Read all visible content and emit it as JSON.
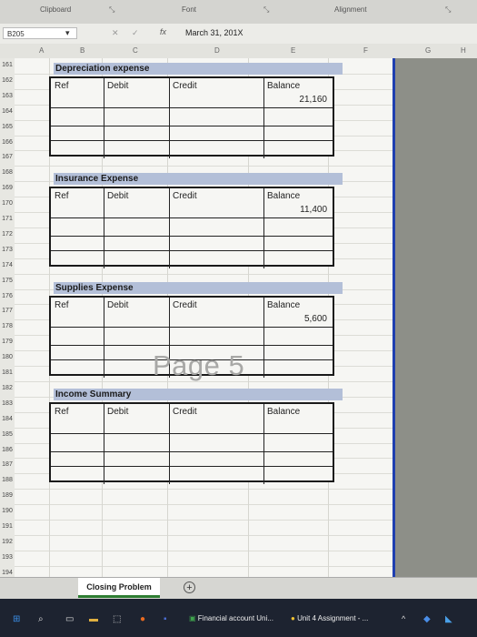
{
  "ribbon": {
    "clipboard": "Clipboard",
    "font": "Font",
    "alignment": "Alignment"
  },
  "formula_bar": {
    "name_box": "B205",
    "fx": "fx",
    "content": "March 31, 201X"
  },
  "columns": [
    "A",
    "B",
    "C",
    "D",
    "E",
    "F",
    "G",
    "H"
  ],
  "rows": [
    "161",
    "162",
    "163",
    "164",
    "165",
    "166",
    "167",
    "168",
    "169",
    "170",
    "171",
    "172",
    "173",
    "174",
    "175",
    "176",
    "177",
    "178",
    "179",
    "180",
    "181",
    "182",
    "183",
    "184",
    "185",
    "186",
    "187",
    "188",
    "189",
    "190",
    "191",
    "192",
    "193",
    "194"
  ],
  "headers": {
    "ref": "Ref",
    "debit": "Debit",
    "credit": "Credit",
    "balance": "Balance"
  },
  "accounts": [
    {
      "title": "Depreciation expense",
      "balance": "21,160"
    },
    {
      "title": "Insurance Expense",
      "balance": "11,400"
    },
    {
      "title": "Supplies Expense",
      "balance": "5,600"
    },
    {
      "title": "Income Summary",
      "balance": ""
    }
  ],
  "watermark": "Page 5",
  "sheet_tab": "Closing Problem",
  "taskbar": {
    "item1": "Financial account Uni...",
    "item2": "Unit 4 Assignment - ..."
  }
}
